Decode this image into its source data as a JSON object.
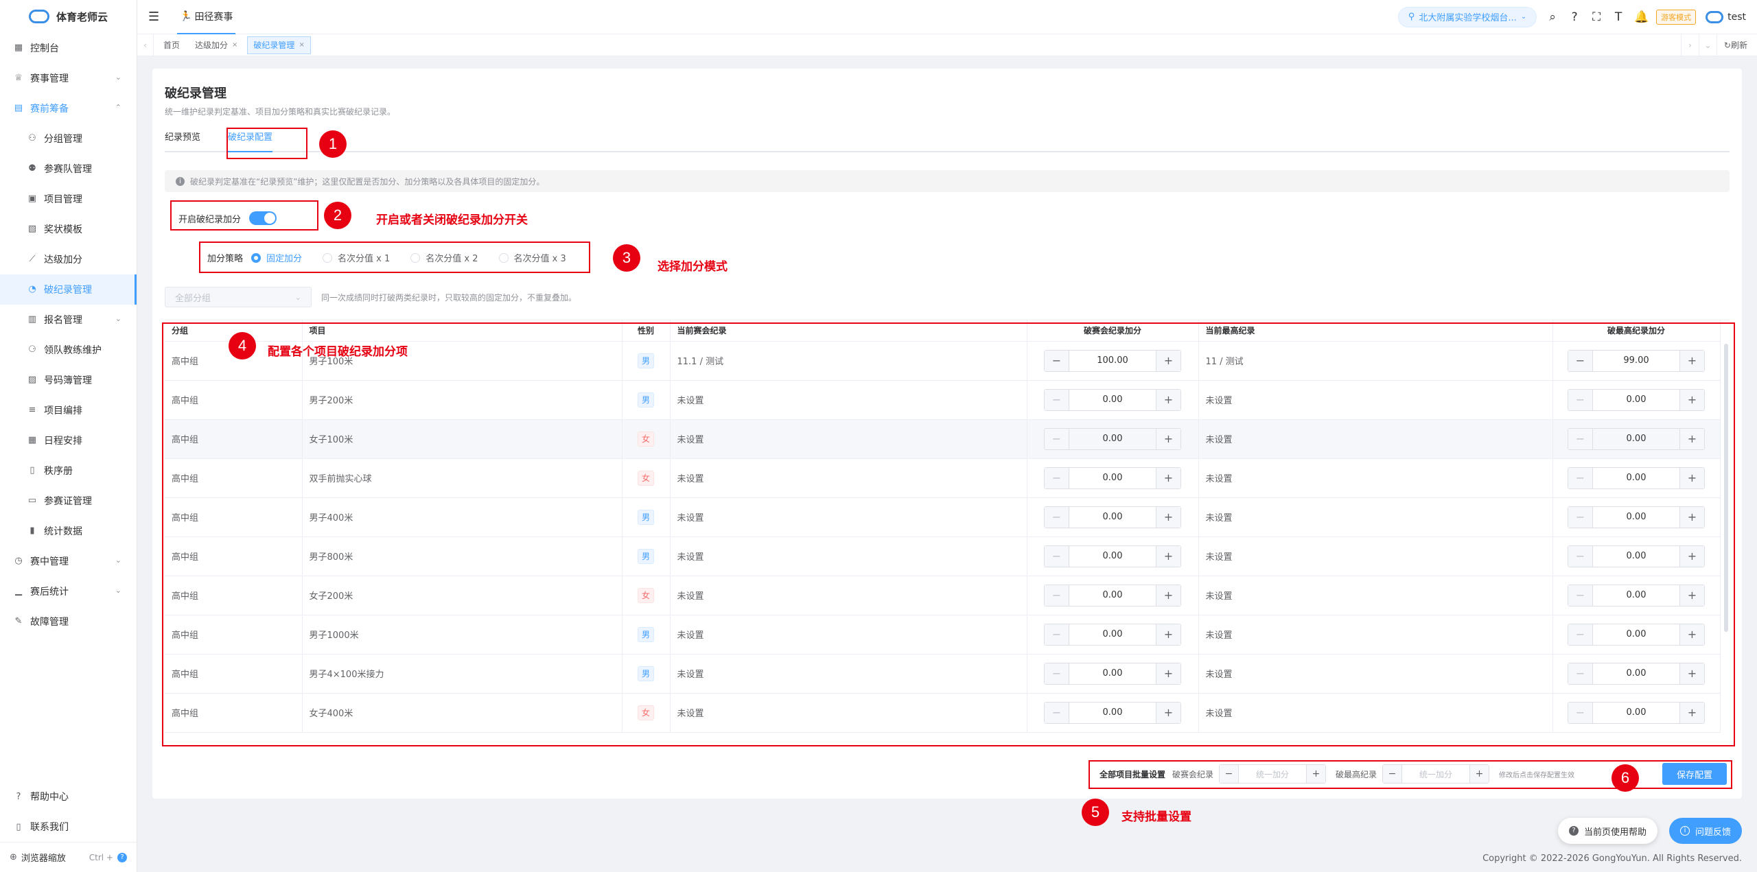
{
  "app": {
    "name": "体育老师云"
  },
  "sidebar": {
    "items": [
      {
        "label": "控制台",
        "icon": "dashboard-icon",
        "level": 0
      },
      {
        "label": "赛事管理",
        "icon": "trophy-icon",
        "level": 0,
        "chevron": "down"
      },
      {
        "label": "赛前筹备",
        "icon": "document-icon",
        "level": 0,
        "chevron": "up",
        "open": true
      },
      {
        "label": "分组管理",
        "icon": "group-icon",
        "level": 1
      },
      {
        "label": "参赛队管理",
        "icon": "team-icon",
        "level": 1
      },
      {
        "label": "项目管理",
        "icon": "clipboard-icon",
        "level": 1
      },
      {
        "label": "奖状模板",
        "icon": "certificate-icon",
        "level": 1
      },
      {
        "label": "达级加分",
        "icon": "chart-line-icon",
        "level": 1
      },
      {
        "label": "破纪录管理",
        "icon": "record-icon",
        "level": 1,
        "active": true
      },
      {
        "label": "报名管理",
        "icon": "register-icon",
        "level": 1,
        "chevron": "down"
      },
      {
        "label": "领队教练维护",
        "icon": "coach-icon",
        "level": 1
      },
      {
        "label": "号码簿管理",
        "icon": "bib-icon",
        "level": 1
      },
      {
        "label": "项目编排",
        "icon": "schedule-list-icon",
        "level": 1
      },
      {
        "label": "日程安排",
        "icon": "calendar-icon",
        "level": 1
      },
      {
        "label": "秩序册",
        "icon": "book-icon",
        "level": 1
      },
      {
        "label": "参赛证管理",
        "icon": "id-card-icon",
        "level": 1
      },
      {
        "label": "统计数据",
        "icon": "bar-chart-icon",
        "level": 1
      },
      {
        "label": "赛中管理",
        "icon": "timer-icon",
        "level": 0,
        "chevron": "down"
      },
      {
        "label": "赛后统计",
        "icon": "stats-icon",
        "level": 0,
        "chevron": "down"
      },
      {
        "label": "故障管理",
        "icon": "wrench-icon",
        "level": 0
      }
    ],
    "bottom": [
      {
        "label": "帮助中心",
        "icon": "help-circle-icon"
      },
      {
        "label": "联系我们",
        "icon": "phone-icon"
      }
    ],
    "zoom": {
      "label": "浏览器缩放",
      "shortcut": "Ctrl +"
    }
  },
  "header": {
    "nav_tab": "田径赛事",
    "school": "北大附属实验学校烟台...",
    "guest_mode": "游客模式",
    "username": "test"
  },
  "tagsbar": {
    "tags": [
      {
        "label": "首页",
        "closable": false,
        "active": false
      },
      {
        "label": "达级加分",
        "closable": true,
        "active": false
      },
      {
        "label": "破纪录管理",
        "closable": true,
        "active": true
      }
    ],
    "refresh": "刷新"
  },
  "page": {
    "title": "破纪录管理",
    "subtitle": "统一维护纪录判定基准、项目加分策略和真实比赛破纪录记录。",
    "tabs": [
      {
        "label": "纪录预览",
        "active": false
      },
      {
        "label": "破纪录配置",
        "active": true
      }
    ],
    "info": "破纪录判定基准在“纪录预览”维护；这里仅配置是否加分、加分策略以及各具体项目的固定加分。",
    "switch_label": "开启破纪录加分",
    "switch_on": true,
    "strategy": {
      "label": "加分策略",
      "options": [
        "固定加分",
        "名次分值 x 1",
        "名次分值 x 2",
        "名次分值 x 3"
      ],
      "selected": 0
    },
    "group_filter": {
      "placeholder": "全部分组"
    },
    "filter_hint": "同一次成绩同时打破两类纪录时，只取较高的固定加分，不重复叠加。"
  },
  "table": {
    "headers": [
      "分组",
      "项目",
      "性别",
      "当前赛会纪录",
      "破赛会纪录加分",
      "当前最高纪录",
      "破最高纪录加分"
    ],
    "rows": [
      {
        "group": "高中组",
        "event": "男子100米",
        "gender": "男",
        "meet_record": "11.1 / 测试",
        "meet_bonus": "100.00",
        "best_record": "11 / 测试",
        "best_bonus": "99.00"
      },
      {
        "group": "高中组",
        "event": "男子200米",
        "gender": "男",
        "meet_record": "未设置",
        "meet_bonus": "0.00",
        "best_record": "未设置",
        "best_bonus": "0.00"
      },
      {
        "group": "高中组",
        "event": "女子100米",
        "gender": "女",
        "meet_record": "未设置",
        "meet_bonus": "0.00",
        "best_record": "未设置",
        "best_bonus": "0.00"
      },
      {
        "group": "高中组",
        "event": "双手前抛实心球",
        "gender": "女",
        "meet_record": "未设置",
        "meet_bonus": "0.00",
        "best_record": "未设置",
        "best_bonus": "0.00"
      },
      {
        "group": "高中组",
        "event": "男子400米",
        "gender": "男",
        "meet_record": "未设置",
        "meet_bonus": "0.00",
        "best_record": "未设置",
        "best_bonus": "0.00"
      },
      {
        "group": "高中组",
        "event": "男子800米",
        "gender": "男",
        "meet_record": "未设置",
        "meet_bonus": "0.00",
        "best_record": "未设置",
        "best_bonus": "0.00"
      },
      {
        "group": "高中组",
        "event": "女子200米",
        "gender": "女",
        "meet_record": "未设置",
        "meet_bonus": "0.00",
        "best_record": "未设置",
        "best_bonus": "0.00"
      },
      {
        "group": "高中组",
        "event": "男子1000米",
        "gender": "男",
        "meet_record": "未设置",
        "meet_bonus": "0.00",
        "best_record": "未设置",
        "best_bonus": "0.00"
      },
      {
        "group": "高中组",
        "event": "男子4×100米接力",
        "gender": "男",
        "meet_record": "未设置",
        "meet_bonus": "0.00",
        "best_record": "未设置",
        "best_bonus": "0.00"
      },
      {
        "group": "高中组",
        "event": "女子400米",
        "gender": "女",
        "meet_record": "未设置",
        "meet_bonus": "0.00",
        "best_record": "未设置",
        "best_bonus": "0.00"
      }
    ]
  },
  "batch": {
    "title": "全部项目批量设置",
    "meet_label": "破赛会纪录",
    "best_label": "破最高纪录",
    "placeholder": "统一加分",
    "hint": "修改后点击保存配置生效",
    "save_label": "保存配置"
  },
  "annotations": [
    {
      "num": "1",
      "text": ""
    },
    {
      "num": "2",
      "text": "开启或者关闭破纪录加分开关"
    },
    {
      "num": "3",
      "text": "选择加分模式"
    },
    {
      "num": "4",
      "text": "配置各个项目破纪录加分项"
    },
    {
      "num": "5",
      "text": "支持批量设置"
    },
    {
      "num": "6",
      "text": ""
    }
  ],
  "floating": {
    "help": "当前页使用帮助",
    "feedback": "问题反馈"
  },
  "footer": "Copyright © 2022-2026 GongYouYun. All Rights Reserved.",
  "colors": {
    "primary": "#409eff",
    "annotation": "#e60012",
    "female": "#f56c6c"
  }
}
